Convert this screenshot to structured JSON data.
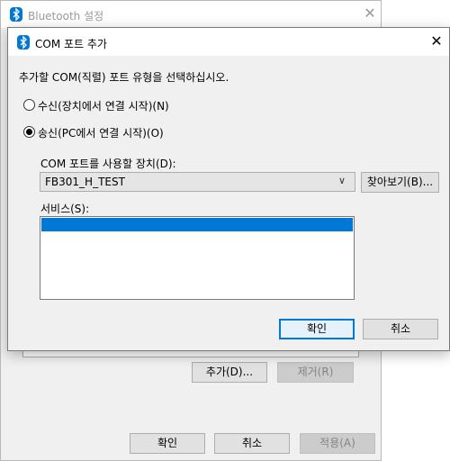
{
  "background_window": {
    "title": "Bluetooth 설정",
    "close_icon": "✕",
    "buttons": {
      "add": "추가(D)...",
      "remove": "제거(R)",
      "ok": "확인",
      "cancel": "취소",
      "apply": "적용(A)"
    }
  },
  "dialog": {
    "title": "COM 포트 추가",
    "close_icon": "✕",
    "instruction": "추가할 COM(직렬) 포트 유형을 선택하십시오.",
    "radio_incoming": "수신(장치에서 연결 시작)(N)",
    "radio_outgoing": "송신(PC에서 연결 시작)(O)",
    "selected_radio": "outgoing",
    "port_device_label": "COM 포트를 사용할 장치(D):",
    "device_value": "FB301_H_TEST",
    "dropdown_icon": "∨",
    "browse_button": "찾아보기(B)...",
    "services_label": "서비스(S):",
    "ok_button": "확인",
    "cancel_button": "취소"
  },
  "colors": {
    "accent": "#0078d7",
    "bluetooth_icon": "#0078d7"
  }
}
